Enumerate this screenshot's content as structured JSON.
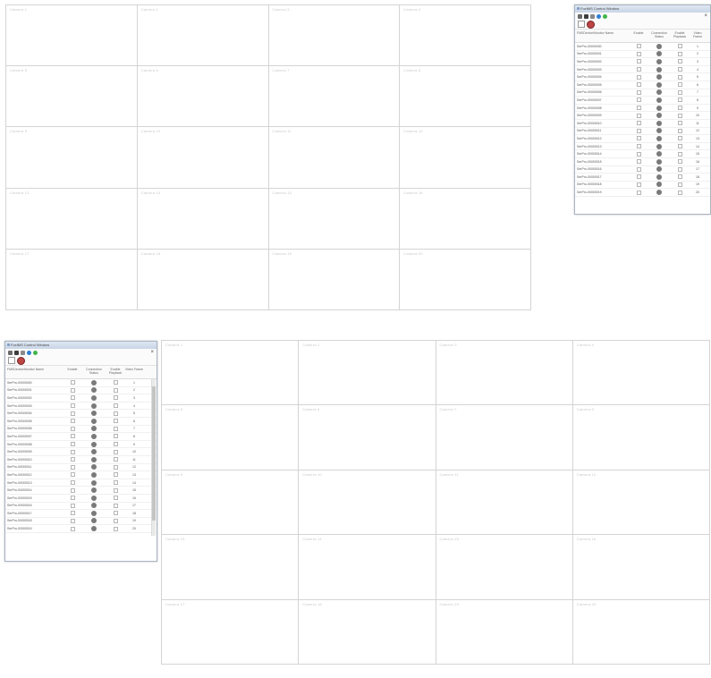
{
  "grid_top": {
    "cells": [
      "Camera 1",
      "Camera 2",
      "Camera 3",
      "Camera 4",
      "Camera 5",
      "Camera 6",
      "Camera 7",
      "Camera 8",
      "Camera 9",
      "Camera 10",
      "Camera 11",
      "Camera 12",
      "Camera 13",
      "Camera 14",
      "Camera 15",
      "Camera 16",
      "Camera 17",
      "Camera 18",
      "Camera 19",
      "Camera 20"
    ]
  },
  "grid_bottom": {
    "cells": [
      "Camera 1",
      "Camera 2",
      "Camera 3",
      "Camera 4",
      "Camera 5",
      "Camera 6",
      "Camera 7",
      "Camera 8",
      "Camera 9",
      "Camera 10",
      "Camera 11",
      "Camera 12",
      "Camera 13",
      "Camera 14",
      "Camera 15",
      "Camera 16",
      "Camera 17",
      "Camera 18",
      "Camera 19",
      "Camera 20"
    ]
  },
  "panel_right": {
    "title": "FoxIMS Control Window",
    "columns": [
      "FMSDevice/Monitor Name",
      "Enable",
      "Connection Status",
      "Enable Playback",
      "Video Frame"
    ],
    "rows": [
      {
        "name": "SerPro-00000000",
        "frame": "1"
      },
      {
        "name": "SerPro-00000001",
        "frame": "2"
      },
      {
        "name": "SerPro-00000002",
        "frame": "3"
      },
      {
        "name": "SerPro-00000003",
        "frame": "4"
      },
      {
        "name": "SerPro-00000004",
        "frame": "5"
      },
      {
        "name": "SerPro-00000005",
        "frame": "6"
      },
      {
        "name": "SerPro-00000006",
        "frame": "7"
      },
      {
        "name": "SerPro-00000007",
        "frame": "8"
      },
      {
        "name": "SerPro-00000008",
        "frame": "9"
      },
      {
        "name": "SerPro-00000009",
        "frame": "10"
      },
      {
        "name": "SerPro-00000010",
        "frame": "11"
      },
      {
        "name": "SerPro-00000011",
        "frame": "12"
      },
      {
        "name": "SerPro-00000012",
        "frame": "13"
      },
      {
        "name": "SerPro-00000013",
        "frame": "14"
      },
      {
        "name": "SerPro-00000014",
        "frame": "15"
      },
      {
        "name": "SerPro-00000015",
        "frame": "16"
      },
      {
        "name": "SerPro-00000016",
        "frame": "17"
      },
      {
        "name": "SerPro-00000017",
        "frame": "18"
      },
      {
        "name": "SerPro-00000018",
        "frame": "19"
      },
      {
        "name": "SerPro-00000019",
        "frame": "20"
      }
    ]
  },
  "panel_left": {
    "title": "FoxIMS Control Window",
    "columns": [
      "FMSDevice/Monitor Name",
      "Enable",
      "Connection Status",
      "Enable Playback",
      "Video Frame"
    ],
    "rows": [
      {
        "name": "SerPro-00000000",
        "frame": "1"
      },
      {
        "name": "SerPro-00000001",
        "frame": "2"
      },
      {
        "name": "SerPro-00000002",
        "frame": "3"
      },
      {
        "name": "SerPro-00000003",
        "frame": "4"
      },
      {
        "name": "SerPro-00000004",
        "frame": "5"
      },
      {
        "name": "SerPro-00000005",
        "frame": "6"
      },
      {
        "name": "SerPro-00000006",
        "frame": "7"
      },
      {
        "name": "SerPro-00000007",
        "frame": "8"
      },
      {
        "name": "SerPro-00000008",
        "frame": "9"
      },
      {
        "name": "SerPro-00000009",
        "frame": "10"
      },
      {
        "name": "SerPro-00000010",
        "frame": "11"
      },
      {
        "name": "SerPro-00000011",
        "frame": "12"
      },
      {
        "name": "SerPro-00000012",
        "frame": "13"
      },
      {
        "name": "SerPro-00000013",
        "frame": "14"
      },
      {
        "name": "SerPro-00000014",
        "frame": "15"
      },
      {
        "name": "SerPro-00000015",
        "frame": "16"
      },
      {
        "name": "SerPro-00000016",
        "frame": "17"
      },
      {
        "name": "SerPro-00000017",
        "frame": "18"
      },
      {
        "name": "SerPro-00000018",
        "frame": "19"
      },
      {
        "name": "SerPro-00000019",
        "frame": "20"
      }
    ]
  },
  "colors": {
    "grid_line": "#d4d4d4",
    "status_dot": "#7a7a7a",
    "help_icon": "#2e7fd6",
    "refresh_icon": "#42b54a",
    "stop_icon": "#b44444"
  },
  "icons": [
    "print-icon",
    "save-icon",
    "edit-icon",
    "help-icon",
    "refresh-icon",
    "check-icon",
    "stop-icon",
    "close-icon"
  ]
}
